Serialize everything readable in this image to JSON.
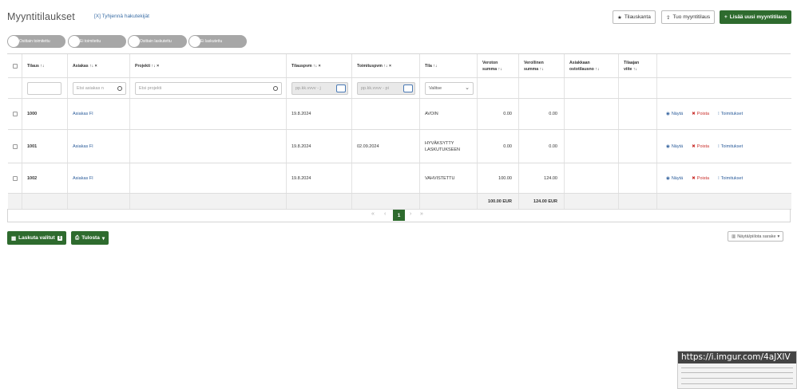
{
  "page": {
    "title": "Myyntitilaukset",
    "clear_filters": "[X] Tyhjennä hakutekijät"
  },
  "toolbar": {
    "order_form": "Tilauskanta",
    "import": "Tuo myyntitilaus",
    "add_new": "Lisää uusi myyntitilaus"
  },
  "toggles": [
    "Osittain toimitettu",
    "Ei toimitettu",
    "Osittain laskutettu",
    "Ei laskutettu"
  ],
  "columns": {
    "order": "Tilaus ↑↓",
    "customer": "Asiakas ↑↓ ×",
    "project": "Projekti ↑↓ ×",
    "order_date": "Tilauspvm ↑↓ ×",
    "delivery_date": "Toimituspvm ↑↓ ×",
    "status": "Tila ↑↓",
    "net_sum_l1": "Veroton",
    "net_sum_l2": "summa ↑↓",
    "gross_sum_l1": "Verollinen",
    "gross_sum_l2": "summa ↑↓",
    "customer_order_no_l1": "Asiakkaan",
    "customer_order_no_l2": "ostotilausno ↑↓",
    "buyer_ref_l1": "Tilaajan",
    "buyer_ref_l2": "viite ↑↓"
  },
  "filters": {
    "customer_placeholder": "Etsi asiakas n",
    "project_placeholder": "Etsi projekti",
    "order_date_placeholder": "pp.kk.vvvv - j",
    "delivery_date_placeholder": "pp.kk.vvvv - pi",
    "status_select": "Valitse"
  },
  "rows": [
    {
      "order": "1000",
      "customer": "Asiakas FI",
      "project": "",
      "order_date": "19.8.2024",
      "delivery_date": "",
      "status": "AVOIN",
      "status2": "",
      "net": "0.00",
      "gross": "0.00",
      "cust_order": "",
      "buyer_ref": ""
    },
    {
      "order": "1001",
      "customer": "Asiakas FI",
      "project": "",
      "order_date": "19.8.2024",
      "delivery_date": "02.09.2024",
      "status": "HYVÄKSYTTY",
      "status2": "LASKUTUKSEEN",
      "net": "0.00",
      "gross": "0.00",
      "cust_order": "",
      "buyer_ref": ""
    },
    {
      "order": "1002",
      "customer": "Asiakas FI",
      "project": "",
      "order_date": "19.8.2024",
      "delivery_date": "",
      "status": "VAHVISTETTU",
      "status2": "",
      "net": "100.00",
      "gross": "124.00",
      "cust_order": "",
      "buyer_ref": ""
    }
  ],
  "actions": {
    "view": "Näytä",
    "delete": "Poista",
    "deliveries": "Toimitukset"
  },
  "totals": {
    "net": "100.00 EUR",
    "gross": "124.00 EUR"
  },
  "pagination": {
    "first": "«",
    "prev": "‹",
    "current": "1",
    "next": "›",
    "last": "»"
  },
  "bottom": {
    "invoice_selected": "Laskuta valitut",
    "invoice_count": "0",
    "print": "Tulosta",
    "show_hide_columns": "Näytä/piilota sarake"
  },
  "thumbnail": {
    "url": "https://i.imgur.com/4aJXIV"
  },
  "icons": [
    "star-icon",
    "upload-icon",
    "plus-icon",
    "search-icon",
    "calendar-icon",
    "chevron-down-icon",
    "eye-icon",
    "close-icon",
    "truck-icon",
    "calculator-icon",
    "printer-icon",
    "columns-icon"
  ],
  "colors": {
    "primary": "#2e6b2e",
    "link": "#2b5c9a",
    "danger": "#c9302c",
    "toggle": "#a7a7a7"
  }
}
